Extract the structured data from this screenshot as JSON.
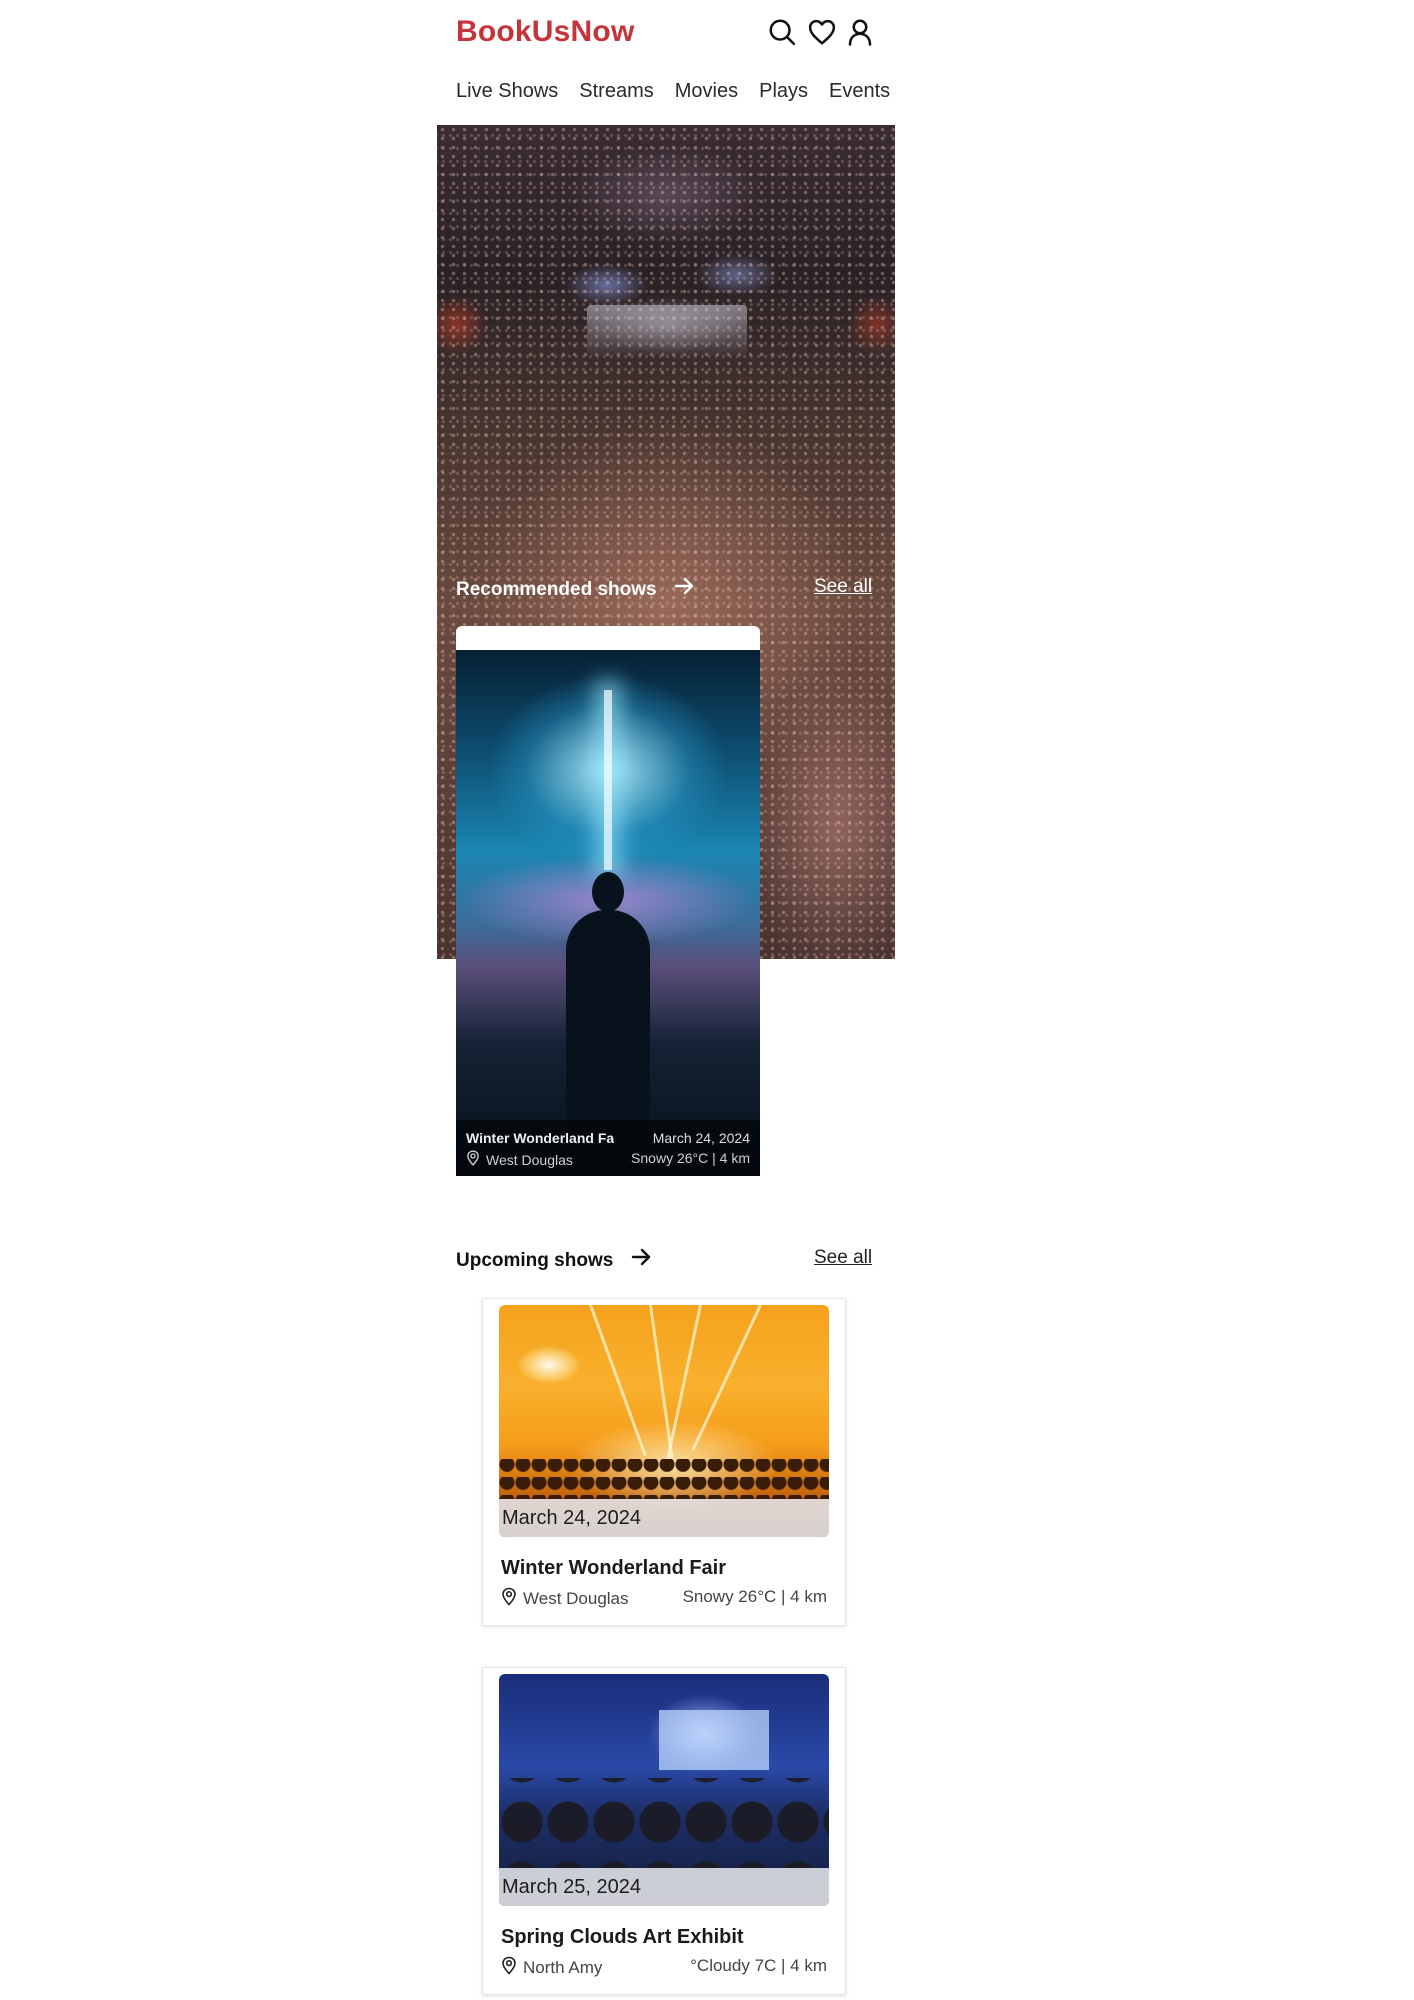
{
  "header": {
    "logo": "BookUsNow",
    "icons": [
      "search-icon",
      "heart-icon",
      "user-icon"
    ]
  },
  "nav": {
    "items": [
      "Live Shows",
      "Streams",
      "Movies",
      "Plays",
      "Events"
    ]
  },
  "recommended": {
    "title": "Recommended shows",
    "see_all": "See all",
    "cards": [
      {
        "name": "Winter Wonderland Fair",
        "date": "March 24, 2024",
        "location": "West Douglas",
        "weather": "Snowy 26°C | 4 km"
      }
    ]
  },
  "upcoming": {
    "title": "Upcoming shows",
    "see_all": "See all",
    "cards": [
      {
        "date": "March 24, 2024",
        "name": "Winter Wonderland Fair",
        "location": "West Douglas",
        "weather": "Snowy 26°C | 4 km"
      },
      {
        "date": "March 25, 2024",
        "name": "Spring Clouds Art Exhibit",
        "location": "North Amy",
        "weather": "°Cloudy 7C | 4 km"
      }
    ]
  },
  "colors": {
    "brand": "#c5343a",
    "text": "#1a1a1a"
  }
}
